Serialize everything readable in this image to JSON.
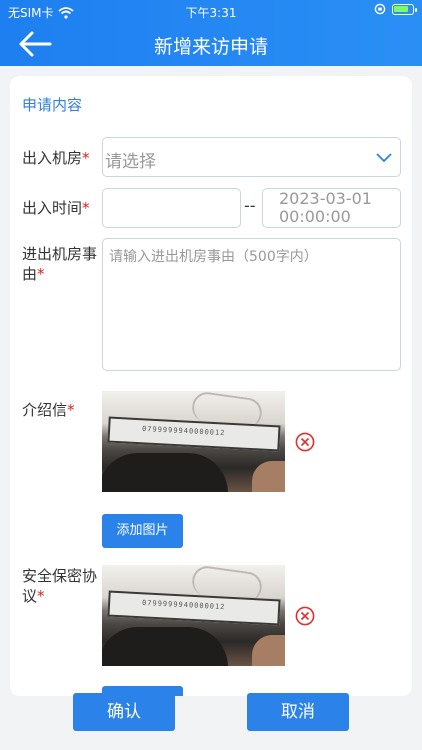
{
  "status_bar": {
    "carrier": "无SIM卡",
    "time": "下午3:31",
    "icons": [
      "wifi-icon",
      "orientation-lock-icon",
      "battery-charging-icon"
    ]
  },
  "nav": {
    "title": "新增来访申请",
    "back_icon": "back-arrow-icon"
  },
  "form": {
    "section_title": "申请内容",
    "room": {
      "label": "出入机房",
      "placeholder": "请选择"
    },
    "time": {
      "label": "出入时间",
      "start_value": "",
      "separator": "--",
      "end_value": "2023-03-01 00:00:00"
    },
    "reason": {
      "label": "进出机房事由",
      "placeholder": "请输入进出机房事由（500字内）"
    },
    "intro_letter": {
      "label": "介绍信",
      "add_button": "添加图片",
      "photo_serial": "0799999940000012"
    },
    "security_agreement": {
      "label": "安全保密协议",
      "photo_serial": "0799999940000012"
    },
    "required_mark": "*"
  },
  "footer": {
    "confirm": "确认",
    "cancel": "取消"
  },
  "colors": {
    "primary": "#2b83ea",
    "required": "#e02020",
    "delete": "#e03030"
  }
}
